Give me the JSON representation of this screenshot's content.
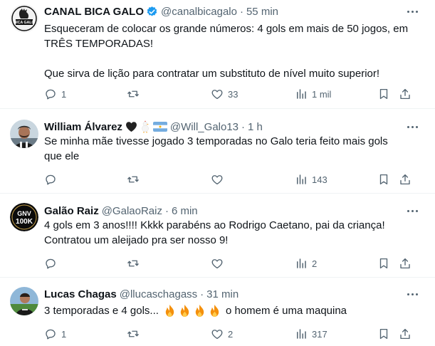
{
  "tweets": [
    {
      "name": "CANAL BICA GALO",
      "handle": "@canalbicagalo",
      "time": "55 min",
      "verified": true,
      "paragraphs": [
        "Esqueceram de colocar os grande números: 4 gols em mais de 50 jogos, em TRÊS TEMPORADAS!",
        "Que sirva de lição para contratar um substituto de nível muito superior!"
      ],
      "replies": "1",
      "retweets": "",
      "likes": "33",
      "views": "1 mil"
    },
    {
      "name": "William Álvarez",
      "handle": "@Will_Galo13",
      "time": "1 h",
      "paragraphs": [
        "Se minha mãe tivesse jogado 3 temporadas no Galo teria feito mais gols que ele"
      ],
      "replies": "",
      "retweets": "",
      "likes": "",
      "views": "143"
    },
    {
      "name": "Galão Raiz",
      "handle": "@GalaoRaiz",
      "time": "6 min",
      "paragraphs": [
        "4 gols em 3 anos!!!! Kkkk parabéns ao Rodrigo Caetano, pai da criança! Contratou um aleijado pra ser nosso 9!"
      ],
      "replies": "",
      "retweets": "",
      "likes": "",
      "views": "2"
    },
    {
      "name": "Lucas Chagas",
      "handle": "@llucaschagass",
      "time": "31 min",
      "text_before": "3 temporadas e 4 gols...",
      "text_after": "o homem é uma maquina",
      "replies": "1",
      "retweets": "",
      "likes": "2",
      "views": "317"
    }
  ],
  "avatars": {
    "tweet1_logo_text": "BICA GALO",
    "tweet3_logo_line1": "GNV",
    "tweet3_logo_line2": "100K"
  },
  "colors": {
    "text": "#0f1419",
    "secondary": "#536471",
    "verified": "#1d9bf0",
    "divider": "#eff3f4"
  },
  "icons": [
    "reply-icon",
    "retweet-icon",
    "like-icon",
    "views-icon",
    "bookmark-icon",
    "share-icon",
    "verified-icon",
    "more-icon",
    "fire-icon",
    "black-heart-icon",
    "chicken-icon",
    "argentina-flag-icon"
  ]
}
